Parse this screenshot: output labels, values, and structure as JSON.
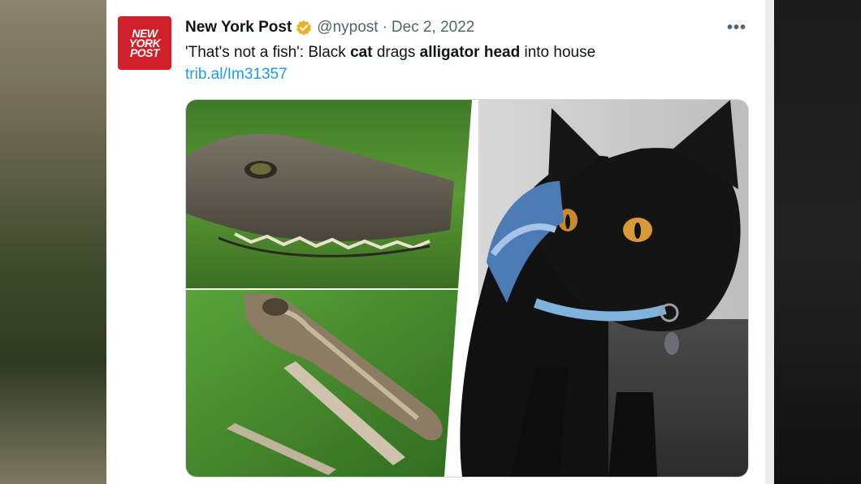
{
  "tweet": {
    "author_name": "New York Post",
    "handle": "@nypost",
    "separator": "·",
    "date": "Dec 2, 2022",
    "more_label": "•••",
    "avatar_lines": [
      "NEW",
      "YORK",
      "POST"
    ],
    "text_parts": [
      {
        "text": "'That's not a fish': Black ",
        "bold": false
      },
      {
        "text": "cat",
        "bold": true
      },
      {
        "text": " drags ",
        "bold": false
      },
      {
        "text": "alligator head",
        "bold": true
      },
      {
        "text": " into house",
        "bold": false
      }
    ],
    "link": "trib.al/Im31357"
  },
  "colors": {
    "avatar_red": "#d2202a",
    "link_blue": "#1d9bf0",
    "verified_gold": "#e8b229",
    "secondary_text": "#536471"
  },
  "icons": {
    "verified": "verified-badge-icon",
    "more": "more-horizontal-icon"
  }
}
